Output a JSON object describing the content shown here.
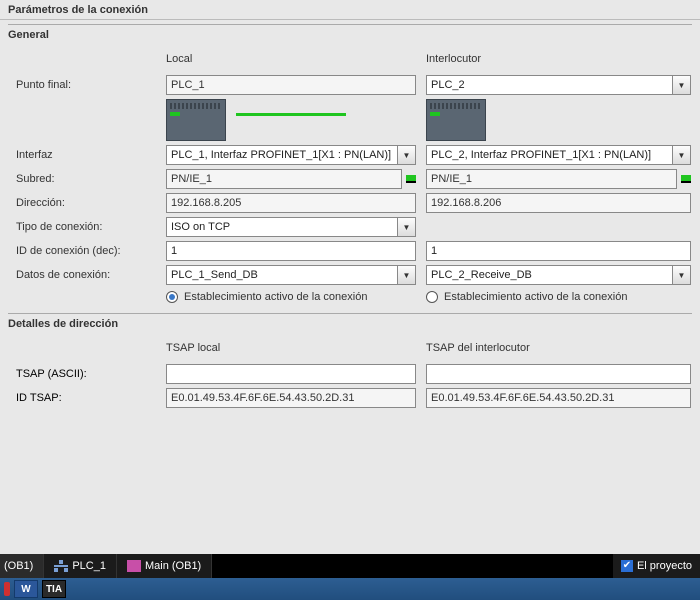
{
  "title": "Parámetros de la conexión",
  "generalSection": "General",
  "colLocal": "Local",
  "colPartner": "Interlocutor",
  "labels": {
    "endpoint": "Punto final:",
    "interface": "Interfaz",
    "subnet": "Subred:",
    "address": "Dirección:",
    "connType": "Tipo de conexión:",
    "connId": "ID de conexión (dec):",
    "connData": "Datos de conexión:",
    "activeEst": "Establecimiento activo de la conexión"
  },
  "local": {
    "endpoint": "PLC_1",
    "interface": "PLC_1, Interfaz PROFINET_1[X1 : PN(LAN)]",
    "subnet": "PN/IE_1",
    "address": "192.168.8.205",
    "connId": "1",
    "connData": "PLC_1_Send_DB"
  },
  "partner": {
    "endpoint": "PLC_2",
    "interface": "PLC_2, Interfaz PROFINET_1[X1 : PN(LAN)]",
    "subnet": "PN/IE_1",
    "address": "192.168.8.206",
    "connId": "1",
    "connData": "PLC_2_Receive_DB"
  },
  "connType": "ISO on TCP",
  "addrSection": "Detalles de dirección",
  "addrLabels": {
    "tsapLocal": "TSAP local",
    "tsapPartner": "TSAP del interlocutor",
    "tsapAscii": "TSAP (ASCII):",
    "idTsap": "ID TSAP:"
  },
  "tsap": {
    "localAscii": "",
    "partnerAscii": "",
    "localId": "E0.01.49.53.4F.6F.6E.54.43.50.2D.31",
    "partnerId": "E0.01.49.53.4F.6F.6E.54.43.50.2D.31"
  },
  "tabs": {
    "ob1cut": "(OB1)",
    "plc1": "PLC_1",
    "main": "Main (OB1)"
  },
  "statusRight": "El proyecto",
  "task": {
    "word": "W",
    "tia": "TIA"
  }
}
